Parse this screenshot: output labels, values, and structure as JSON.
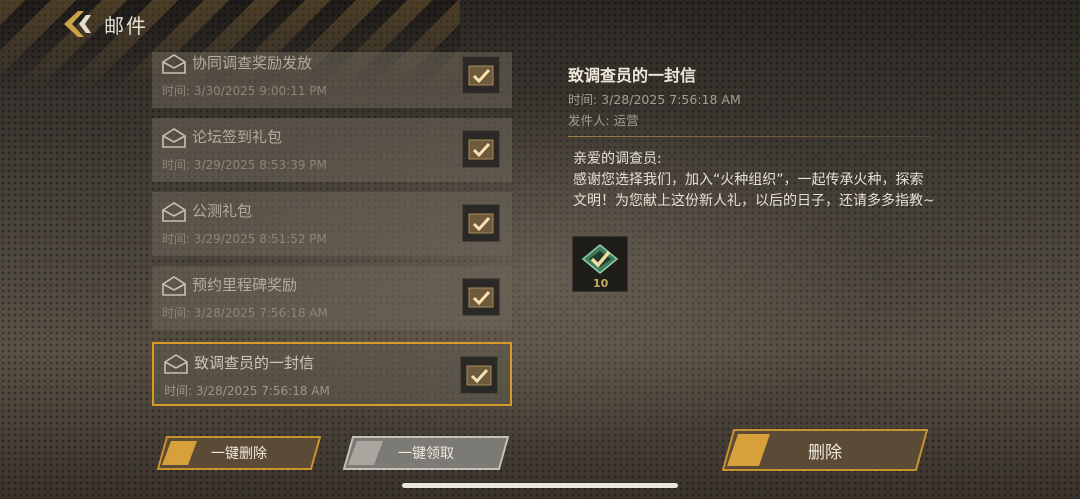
{
  "header": {
    "title": "邮件"
  },
  "mail_list": [
    {
      "title": "协同调查奖励发放",
      "time": "时间: 3/30/2025 9:00:11 PM",
      "state": "read"
    },
    {
      "title": "论坛签到礼包",
      "time": "时间: 3/29/2025 8:53:39 PM",
      "state": "read"
    },
    {
      "title": "公测礼包",
      "time": "时间: 3/29/2025 8:51:52 PM",
      "state": "read"
    },
    {
      "title": "预约里程碑奖励",
      "time": "时间: 3/28/2025 7:56:18 AM",
      "state": "read"
    },
    {
      "title": "致调查员的一封信",
      "time": "时间: 3/28/2025 7:56:18 AM",
      "state": "selected"
    }
  ],
  "detail": {
    "title": "致调查员的一封信",
    "time": "时间: 3/28/2025 7:56:18 AM",
    "sender": "发件人: 运营",
    "greeting": "亲爱的调查员:",
    "body": "感谢您选择我们，加入“火种组织”，一起传承火种，探索文明！为您献上这份新人礼，以后的日子，还请多多指教~",
    "attachment": {
      "icon": "chip-icon",
      "count": "10",
      "claimed": true
    }
  },
  "buttons": {
    "delete_all": "一键删除",
    "claim_all": "一键领取",
    "delete": "删除"
  },
  "colors": {
    "accent": "#d99a2a",
    "claimed_check": "#e8c878"
  }
}
